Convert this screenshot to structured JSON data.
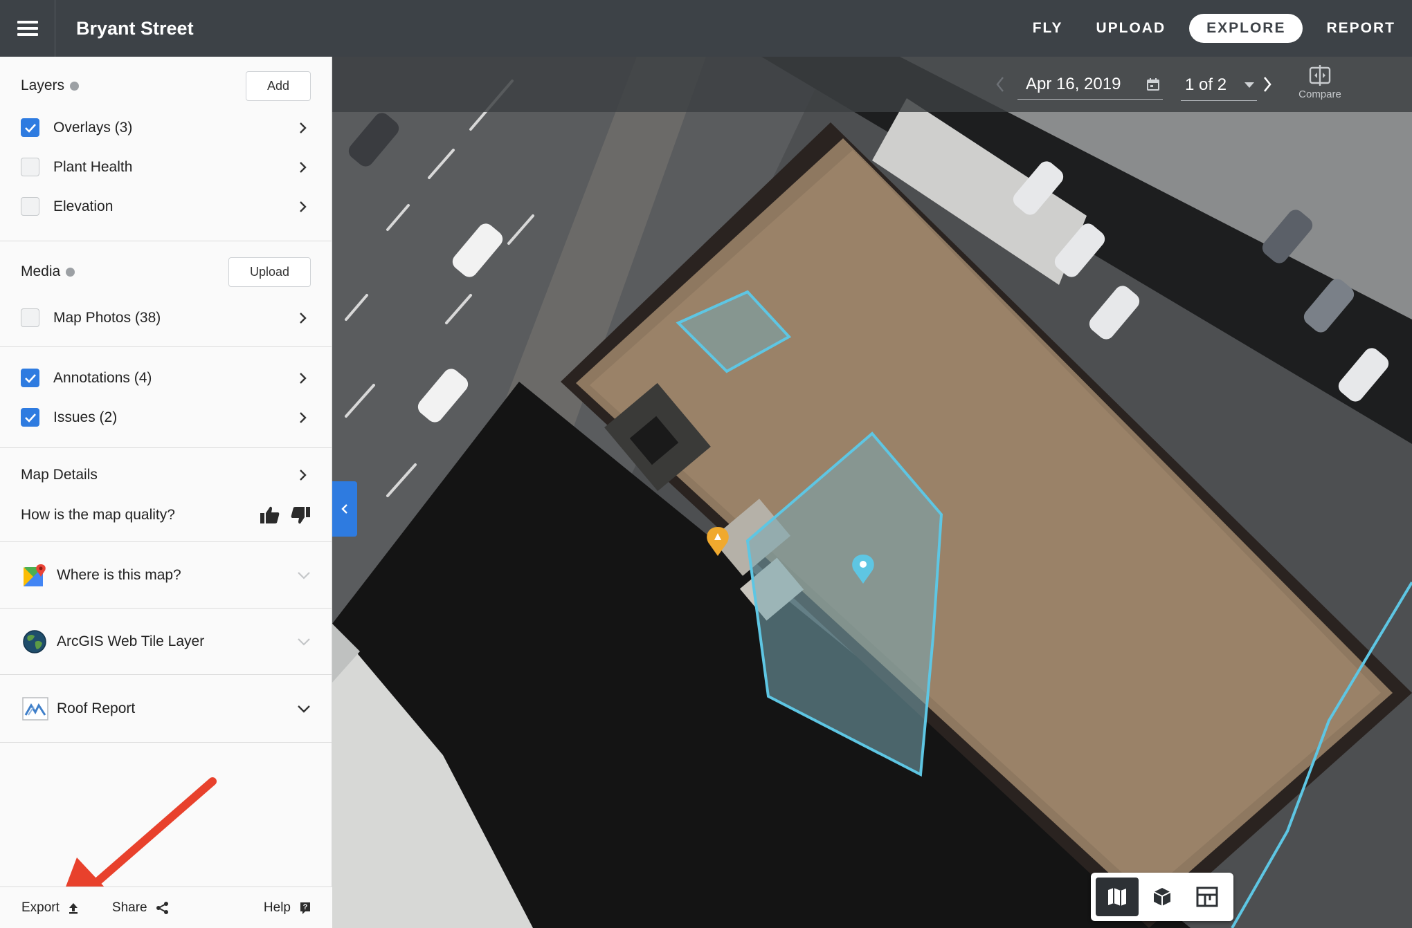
{
  "header": {
    "title": "Bryant Street",
    "nav": [
      {
        "label": "FLY",
        "active": false
      },
      {
        "label": "UPLOAD",
        "active": false
      },
      {
        "label": "EXPLORE",
        "active": true
      },
      {
        "label": "REPORT",
        "active": false
      }
    ]
  },
  "sidebar": {
    "layers": {
      "title": "Layers",
      "add_label": "Add",
      "items": [
        {
          "label": "Overlays (3)",
          "checked": true
        },
        {
          "label": "Plant Health",
          "checked": false
        },
        {
          "label": "Elevation",
          "checked": false
        }
      ]
    },
    "media": {
      "title": "Media",
      "upload_label": "Upload",
      "items": [
        {
          "label": "Map Photos (38)",
          "checked": false
        }
      ]
    },
    "annotations": {
      "items": [
        {
          "label": "Annotations (4)",
          "checked": true
        },
        {
          "label": "Issues (2)",
          "checked": true
        }
      ]
    },
    "map_details": {
      "title": "Map Details",
      "quality_question": "How is the map quality?"
    },
    "integrations": [
      {
        "label": "Where is this map?",
        "icon": "google-maps-icon"
      },
      {
        "label": "ArcGIS Web Tile Layer",
        "icon": "globe-icon"
      },
      {
        "label": "Roof Report",
        "icon": "roof-report-icon"
      }
    ],
    "footer": {
      "export_label": "Export",
      "share_label": "Share",
      "help_label": "Help"
    }
  },
  "map": {
    "date": "Apr 16, 2019",
    "page": "1 of 2",
    "compare_label": "Compare",
    "view_modes": [
      "2d-map-icon",
      "3d-model-icon",
      "layout-icon"
    ],
    "active_view": "2d-map-icon",
    "colors": {
      "accent": "#2e7be0",
      "annotation": "#5ec6e3",
      "issue": "#f0a92e"
    }
  },
  "annotation_arrow": {
    "color": "#e8412c",
    "icon": "red-arrow-pointer"
  }
}
